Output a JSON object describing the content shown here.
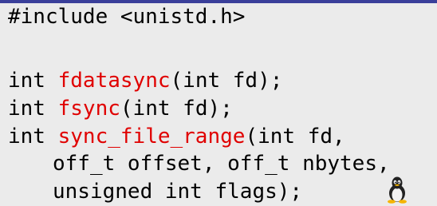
{
  "code": {
    "include": "#include <unistd.h>",
    "line_fdatasync": {
      "prefix": "int ",
      "fn": "fdatasync",
      "suffix": "(int fd);"
    },
    "line_fsync": {
      "prefix": "int ",
      "fn": "fsync",
      "suffix": "(int fd);"
    },
    "line_sync_file_range": {
      "prefix": "int ",
      "fn": "sync_file_range",
      "suffix": "(int fd,"
    },
    "line_args_1": "off_t offset, off_t nbytes,",
    "line_args_2": "unsigned int flags);"
  },
  "icons": {
    "os_logo": "linux-tux-icon"
  },
  "colors": {
    "background": "#ebebeb",
    "text": "#000000",
    "function_name": "#e00000",
    "top_bar": "#3a3f9a"
  }
}
